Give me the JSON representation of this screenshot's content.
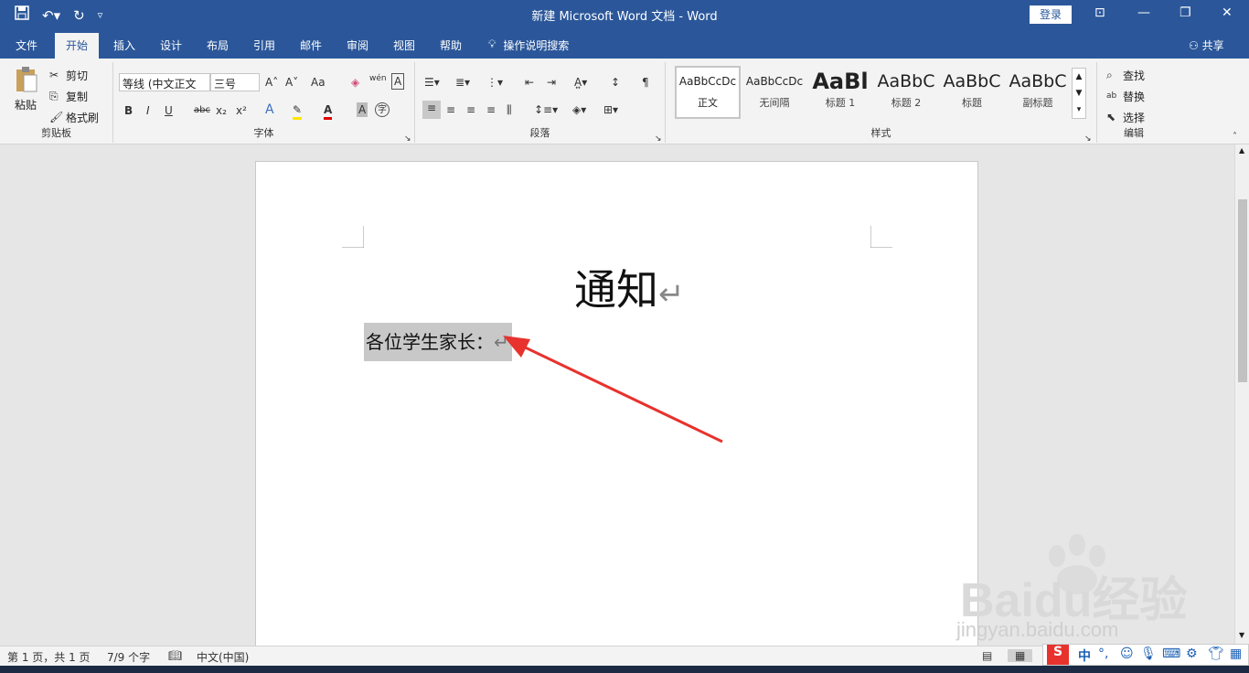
{
  "window": {
    "title": "新建 Microsoft Word 文档  -  Word",
    "login_label": "登录",
    "qat_icons": [
      "save-icon",
      "undo-icon",
      "redo-icon",
      "customize-icon"
    ]
  },
  "tabs": {
    "items": [
      "文件",
      "开始",
      "插入",
      "设计",
      "布局",
      "引用",
      "邮件",
      "审阅",
      "视图",
      "帮助"
    ],
    "active": "开始",
    "search_label": "操作说明搜索",
    "share_label": "共享"
  },
  "ribbon": {
    "clipboard": {
      "label": "剪贴板",
      "paste": "粘贴",
      "cut": "剪切",
      "copy": "复制",
      "format_painter": "格式刷"
    },
    "font": {
      "label": "字体",
      "font_name": "等线 (中文正文",
      "font_size": "三号",
      "case_label": "Aa",
      "phonetic_label": "wén",
      "bold": "B",
      "italic": "I",
      "underline": "U",
      "strike": "abc",
      "subscript": "x₂",
      "superscript": "x²",
      "enclose": "字",
      "text_effect": "A",
      "font_color": "A",
      "char_shading": "A"
    },
    "paragraph": {
      "label": "段落"
    },
    "styles": {
      "label": "样式",
      "items": [
        {
          "preview": "AaBbCcDc",
          "name": "正文"
        },
        {
          "preview": "AaBbCcDc",
          "name": "无间隔"
        },
        {
          "preview": "AaBl",
          "name": "标题 1"
        },
        {
          "preview": "AaBbC",
          "name": "标题 2"
        },
        {
          "preview": "AaBbC",
          "name": "标题"
        },
        {
          "preview": "AaBbC",
          "name": "副标题"
        }
      ]
    },
    "editing": {
      "label": "编辑",
      "find": "查找",
      "replace": "替换",
      "select": "选择"
    }
  },
  "document": {
    "title": "通知",
    "line1": "各位学生家长：",
    "paragraph_mark": "↵"
  },
  "status": {
    "page": "第 1 页，共 1 页",
    "words": "7/9 个字",
    "language": "中文(中国)"
  },
  "watermark": {
    "brand": "Baidu经验",
    "url": "jingyan.baidu.com"
  },
  "ime": {
    "mode": "中"
  },
  "colors": {
    "accent": "#2b579a",
    "highlight": "#c8c8c8",
    "arrow": "#e8322d"
  }
}
